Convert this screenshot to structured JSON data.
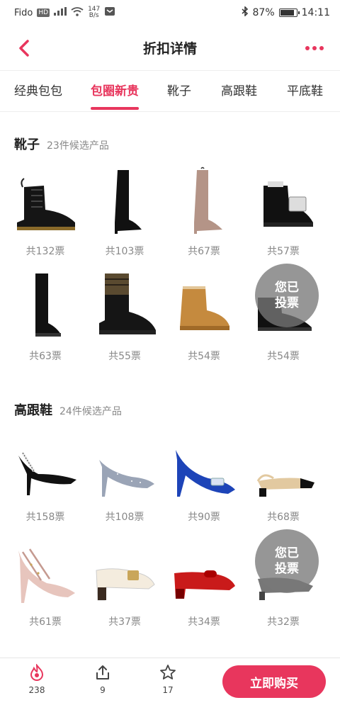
{
  "status_bar": {
    "carrier": "Fido",
    "hd_label": "HD",
    "speed_value": "147",
    "speed_unit": "B/s",
    "battery": "87%",
    "battery_level": 0.87,
    "time": "14:11"
  },
  "nav": {
    "title": "折扣详情"
  },
  "tabs": [
    {
      "label": "经典包包",
      "active": false
    },
    {
      "label": "包圈新贵",
      "active": true
    },
    {
      "label": "靴子",
      "active": false
    },
    {
      "label": "高跟鞋",
      "active": false
    },
    {
      "label": "平底鞋",
      "active": false
    }
  ],
  "sections": [
    {
      "title": "靴子",
      "subtitle": "23件候选产品",
      "products": [
        {
          "votes": "共132票",
          "icon": "combat-boot-icon"
        },
        {
          "votes": "共103票",
          "icon": "over-knee-boot-icon"
        },
        {
          "votes": "共67票",
          "icon": "suede-over-knee-boot-icon"
        },
        {
          "votes": "共57票",
          "icon": "buckle-ankle-boot-icon"
        },
        {
          "votes": "共63票",
          "icon": "knee-high-boot-icon"
        },
        {
          "votes": "共55票",
          "icon": "sock-combat-boot-icon"
        },
        {
          "votes": "共54票",
          "icon": "ugg-boot-icon"
        },
        {
          "votes": "共54票",
          "icon": "chelsea-boot-icon",
          "voted": true
        }
      ]
    },
    {
      "title": "高跟鞋",
      "subtitle": "24件候选产品",
      "products": [
        {
          "votes": "共158票",
          "icon": "slingback-pump-icon"
        },
        {
          "votes": "共108票",
          "icon": "glitter-pump-icon"
        },
        {
          "votes": "共90票",
          "icon": "satin-buckle-pump-icon"
        },
        {
          "votes": "共68票",
          "icon": "two-tone-slingback-icon"
        },
        {
          "votes": "共61票",
          "icon": "studded-pump-icon"
        },
        {
          "votes": "共37票",
          "icon": "buckle-loafer-pump-icon"
        },
        {
          "votes": "共34票",
          "icon": "bow-pump-icon"
        },
        {
          "votes": "共32票",
          "icon": "slingback-icon",
          "voted": true
        }
      ]
    }
  ],
  "voted_label": [
    "您已",
    "投票"
  ],
  "bottom_bar": {
    "likes": "238",
    "shares": "9",
    "favorites": "17",
    "buy_label": "立即购买"
  },
  "colors": {
    "accent": "#e8365d"
  }
}
